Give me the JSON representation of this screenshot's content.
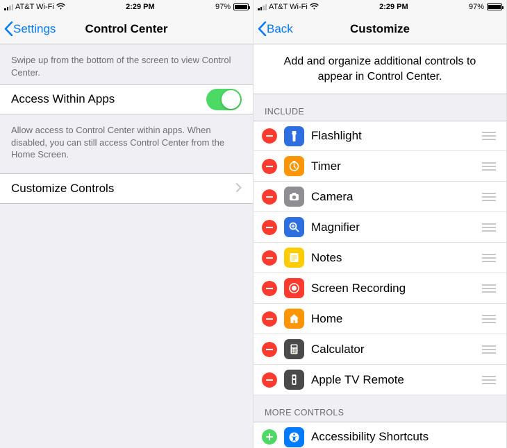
{
  "status": {
    "carrier": "AT&T Wi-Fi",
    "time": "2:29 PM",
    "battery_pct": "97%"
  },
  "left": {
    "back_label": "Settings",
    "title": "Control Center",
    "note1": "Swipe up from the bottom of the screen to view Control Center.",
    "access_label": "Access Within Apps",
    "note2": "Allow access to Control Center within apps. When disabled, you can still access Control Center from the Home Screen.",
    "customize_label": "Customize Controls"
  },
  "right": {
    "back_label": "Back",
    "title": "Customize",
    "intro": "Add and organize additional controls to appear in Control Center.",
    "include_header": "INCLUDE",
    "include": [
      {
        "label": "Flashlight",
        "icon": "flashlight",
        "bg": "bg-blue"
      },
      {
        "label": "Timer",
        "icon": "timer",
        "bg": "bg-orange"
      },
      {
        "label": "Camera",
        "icon": "camera",
        "bg": "bg-gray"
      },
      {
        "label": "Magnifier",
        "icon": "magnifier",
        "bg": "bg-blue"
      },
      {
        "label": "Notes",
        "icon": "notes",
        "bg": "bg-yellow"
      },
      {
        "label": "Screen Recording",
        "icon": "screenrec",
        "bg": "bg-red"
      },
      {
        "label": "Home",
        "icon": "home",
        "bg": "bg-orange"
      },
      {
        "label": "Calculator",
        "icon": "calculator",
        "bg": "bg-darkgray"
      },
      {
        "label": "Apple TV Remote",
        "icon": "atvremote",
        "bg": "bg-darkgray"
      }
    ],
    "more_header": "MORE CONTROLS",
    "more": [
      {
        "label": "Accessibility Shortcuts",
        "icon": "accessibility",
        "bg": "bg-blue2"
      }
    ]
  }
}
